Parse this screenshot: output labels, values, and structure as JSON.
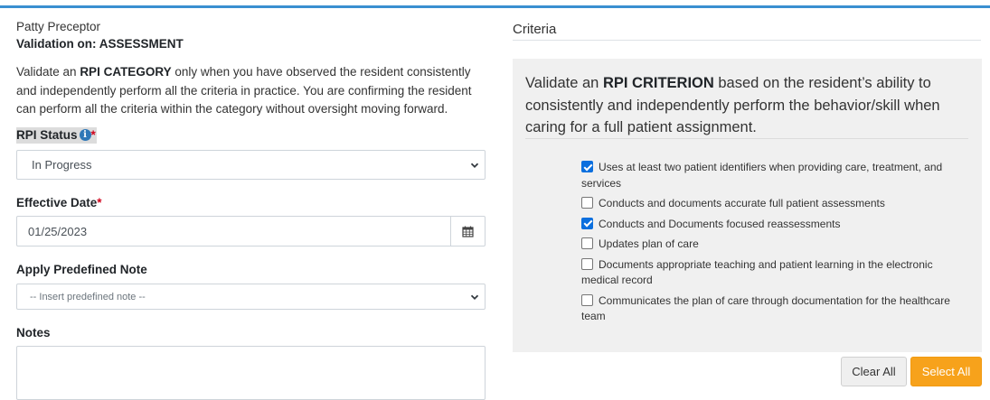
{
  "user": {
    "name": "Patty Preceptor",
    "validation_label": "Validation on:",
    "validation_value": "ASSESSMENT"
  },
  "intro": {
    "prefix": "Validate an ",
    "bold": "RPI CATEGORY",
    "suffix": " only when you have observed the resident consistently and independently perform all the criteria in practice. You are confirming the resident can perform all the criteria within the category without oversight moving forward."
  },
  "form": {
    "rpi_status": {
      "label": "RPI Status",
      "required_mark": "*",
      "info_icon": "info-circle-icon",
      "value": "In Progress"
    },
    "effective_date": {
      "label": "Effective Date",
      "required_mark": "*",
      "value": "01/25/2023",
      "icon": "calendar-icon"
    },
    "predefined_note": {
      "label": "Apply Predefined Note",
      "value": "-- Insert predefined note --"
    },
    "notes": {
      "label": "Notes",
      "value": ""
    }
  },
  "criteria": {
    "title": "Criteria",
    "intro_prefix": "Validate an ",
    "intro_bold": "RPI CRITERION",
    "intro_suffix": " based on the resident’s ability to consistently and independently perform the behavior/skill when caring for a full patient assignment.",
    "items": [
      {
        "label": "Uses at least two patient identifiers when providing care, treatment, and services",
        "checked": true
      },
      {
        "label": "Conducts and documents accurate full patient assessments",
        "checked": false
      },
      {
        "label": "Conducts and Documents focused reassessments",
        "checked": true
      },
      {
        "label": "Updates plan of care",
        "checked": false
      },
      {
        "label": "Documents appropriate teaching and patient learning in the electronic medical record",
        "checked": false
      },
      {
        "label": "Communicates the plan of care through documentation for the healthcare team",
        "checked": false
      }
    ]
  },
  "buttons": {
    "clear_all": "Clear All",
    "select_all": "Select All"
  },
  "colors": {
    "accent_bar": "#3a8fd0",
    "select_all_bg": "#f7a21b",
    "required": "#d0021b",
    "checkbox_checked": "#0b6fde"
  }
}
